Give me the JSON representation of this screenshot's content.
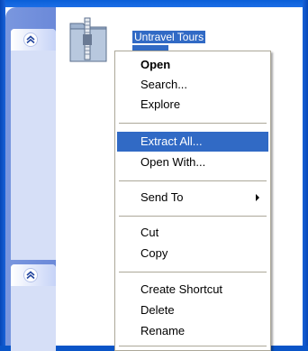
{
  "file": {
    "name": "Untravel Tours",
    "icon": "zip-folder-icon"
  },
  "task_pane": {
    "collapse_icon": "chevron-double-up-icon"
  },
  "context_menu": {
    "open": "Open",
    "search": "Search...",
    "explore": "Explore",
    "extract_all": "Extract All...",
    "open_with": "Open With...",
    "send_to": "Send To",
    "cut": "Cut",
    "copy": "Copy",
    "create_shortcut": "Create Shortcut",
    "delete": "Delete",
    "rename": "Rename",
    "highlighted_item": "Extract All..."
  },
  "colors": {
    "selection": "#316ac5",
    "frame": "#0a55c8",
    "task_pane": "#6b89d9"
  }
}
